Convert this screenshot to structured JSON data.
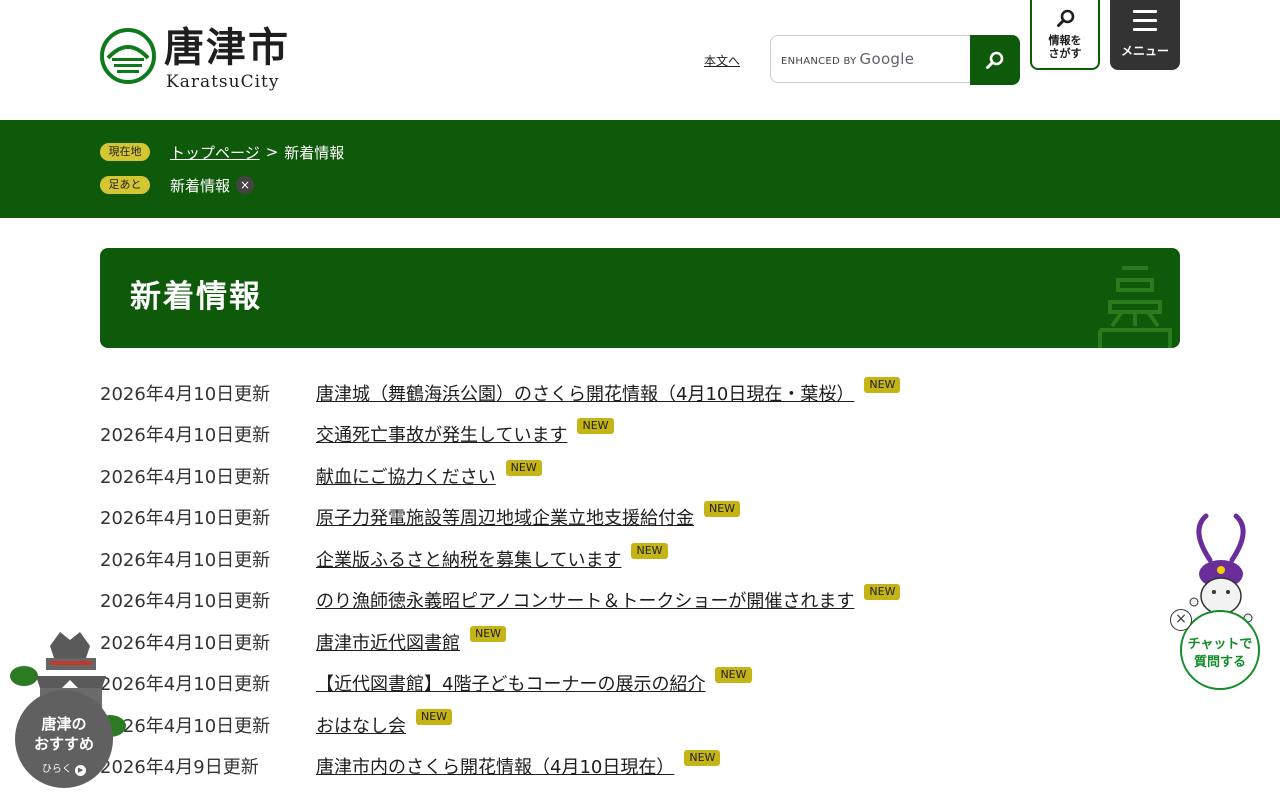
{
  "header": {
    "logo_title": "唐津市",
    "logo_sub": "KaratsuCity",
    "skip_link": "本文へ",
    "search": {
      "enhanced_by": "ENHANCED BY",
      "google": "Google"
    },
    "find_button": "情報を\nさがす",
    "menu_button": "メニュー"
  },
  "breadcrumb": {
    "current_badge": "現在地",
    "trail": [
      "トップページ",
      "新着情報"
    ],
    "separator": ">",
    "history_badge": "足あと",
    "history_item": "新着情報",
    "history_close": "×"
  },
  "page_title": "新着情報",
  "news": [
    {
      "date": "2026年4月10日更新",
      "title": "唐津城（舞鶴海浜公園）のさくら開花情報（4月10日現在・葉桜）",
      "badge": "NEW"
    },
    {
      "date": "2026年4月10日更新",
      "title": "交通死亡事故が発生しています",
      "badge": "NEW"
    },
    {
      "date": "2026年4月10日更新",
      "title": "献血にご協力ください",
      "badge": "NEW"
    },
    {
      "date": "2026年4月10日更新",
      "title": "原子力発電施設等周辺地域企業立地支援給付金",
      "badge": "NEW"
    },
    {
      "date": "2026年4月10日更新",
      "title": "企業版ふるさと納税を募集しています",
      "badge": "NEW"
    },
    {
      "date": "2026年4月10日更新",
      "title": "のり漁師徳永義昭ピアノコンサート＆トークショーが開催されます",
      "badge": "NEW"
    },
    {
      "date": "2026年4月10日更新",
      "title": "唐津市近代図書館",
      "badge": "NEW"
    },
    {
      "date": "2026年4月10日更新",
      "title": "【近代図書館】4階子どもコーナーの展示の紹介",
      "badge": "NEW"
    },
    {
      "date": "2026年4月10日更新",
      "title": "おはなし会",
      "badge": "NEW"
    },
    {
      "date": "2026年4月9日更新",
      "title": "唐津市内のさくら開花情報（4月10日現在）",
      "badge": "NEW"
    }
  ],
  "recommend": {
    "label": "唐津の\nおすすめ",
    "sub": "ひらく"
  },
  "chat": {
    "label": "チャットで\n質問する",
    "close": "×"
  },
  "colors": {
    "brand_green": "#0f5a0a",
    "badge_yellow": "#c4b416",
    "pill_yellow": "#d4c532",
    "chat_green": "#138c29",
    "chat_purple": "#6a2e9a"
  }
}
